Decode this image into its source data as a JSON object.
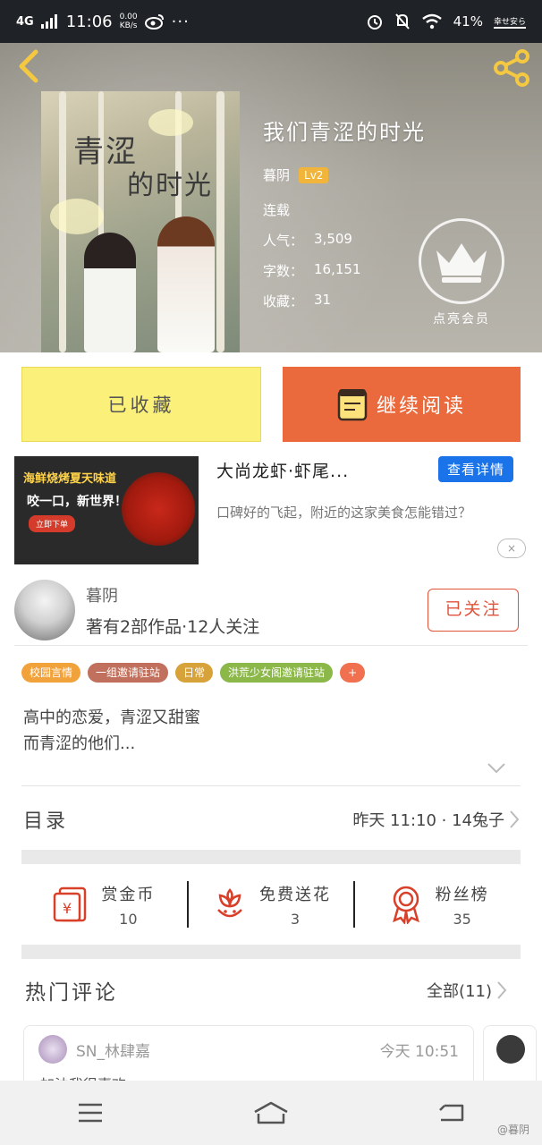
{
  "status_bar": {
    "network": "4G",
    "time": "11:06",
    "speed_value": "0.00",
    "speed_unit": "KB/s",
    "battery": "41%",
    "carrier_tag": "幸せ安ら"
  },
  "book": {
    "title": "我们青涩的时光",
    "author": "暮阴",
    "level": "Lv2",
    "status": "连载",
    "popularity_label": "人气：",
    "popularity": "3,509",
    "words_label": "字数：",
    "words": "16,151",
    "favorites_label": "收藏：",
    "favorites": "31",
    "cover_title_line1": "青涩",
    "cover_title_line2": "的时光"
  },
  "vip": {
    "label": "点亮会员"
  },
  "actions": {
    "favorited_label": "已收藏",
    "continue_label": "继续阅读"
  },
  "ad": {
    "image_line1": "海鲜烧烤夏天味道",
    "image_line2": "咬一口，新世界！",
    "image_cta": "立即下单",
    "title": "大尚龙虾·虾尾...",
    "button": "查看详情",
    "description": "口碑好的飞起，附近的这家美食怎能错过？",
    "close": "×"
  },
  "author_card": {
    "name": "暮阴",
    "stats": "著有2部作品·12人关注",
    "follow_label": "已关注"
  },
  "tags": [
    {
      "label": "校园言情",
      "color": "#f2a23a"
    },
    {
      "label": "一组邀请驻站",
      "color": "#c0705c"
    },
    {
      "label": "日常",
      "color": "#d8a23a"
    },
    {
      "label": "洪荒少女阁邀请驻站",
      "color": "#8cb84a"
    },
    {
      "label": "+",
      "color": "#f07050"
    }
  ],
  "description": {
    "line1": "高中的恋爱，青涩又甜蜜",
    "line2": "而青涩的他们..."
  },
  "catalog": {
    "label": "目录",
    "latest": "昨天 11:10 · 14兔子"
  },
  "stats": [
    {
      "name": "赏金币",
      "value": "10"
    },
    {
      "name": "免费送花",
      "value": "3"
    },
    {
      "name": "粉丝榜",
      "value": "35"
    }
  ],
  "hot_comments": {
    "label": "热门评论",
    "all_label": "全部(11)",
    "comments": [
      {
        "user": "SN_林肆嘉",
        "time": "今天 10:51",
        "text": "加油我很喜欢"
      }
    ]
  },
  "watermark": "@暮阴",
  "colors": {
    "accent": "#eb6a3d",
    "favorite_bg": "#fbf17a",
    "ad_button": "#1a73e8",
    "follow": "#e0533a",
    "stat_icon": "#d8402a"
  }
}
